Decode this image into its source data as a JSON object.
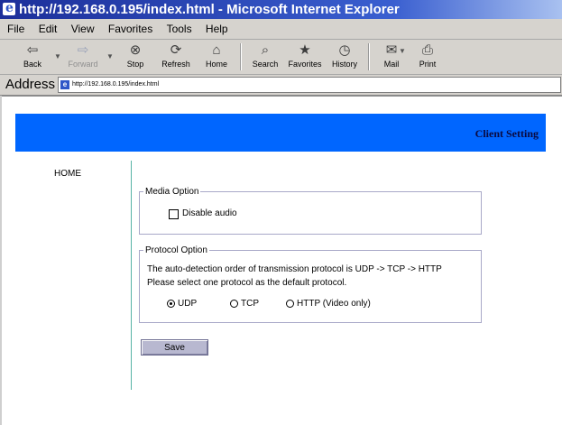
{
  "window": {
    "title": "http://192.168.0.195/index.html - Microsoft Internet Explorer"
  },
  "menu": [
    {
      "label": "File"
    },
    {
      "label": "Edit"
    },
    {
      "label": "View"
    },
    {
      "label": "Favorites"
    },
    {
      "label": "Tools"
    },
    {
      "label": "Help"
    }
  ],
  "toolbar": {
    "back": "Back",
    "forward": "Forward",
    "stop": "Stop",
    "refresh": "Refresh",
    "home": "Home",
    "search": "Search",
    "favorites": "Favorites",
    "history": "History",
    "mail": "Mail",
    "print": "Print"
  },
  "address": {
    "label": "Address",
    "url": "http://192.168.0.195/index.html"
  },
  "page": {
    "banner_title": "Client Setting",
    "nav_home": "HOME",
    "media": {
      "legend": "Media Option",
      "disable_audio_label": "Disable audio",
      "disable_audio_checked": false
    },
    "protocol": {
      "legend": "Protocol Option",
      "line1": "The auto-detection order of transmission protocol is UDP -> TCP -> HTTP",
      "line2": "Please select one protocol as the default protocol.",
      "options": [
        "UDP",
        "TCP",
        "HTTP (Video only)"
      ],
      "selected": "UDP"
    },
    "save_label": "Save"
  },
  "colors": {
    "banner": "#0066ff",
    "titlebar": "#1c2f9a",
    "divider": "#57b3a6"
  }
}
